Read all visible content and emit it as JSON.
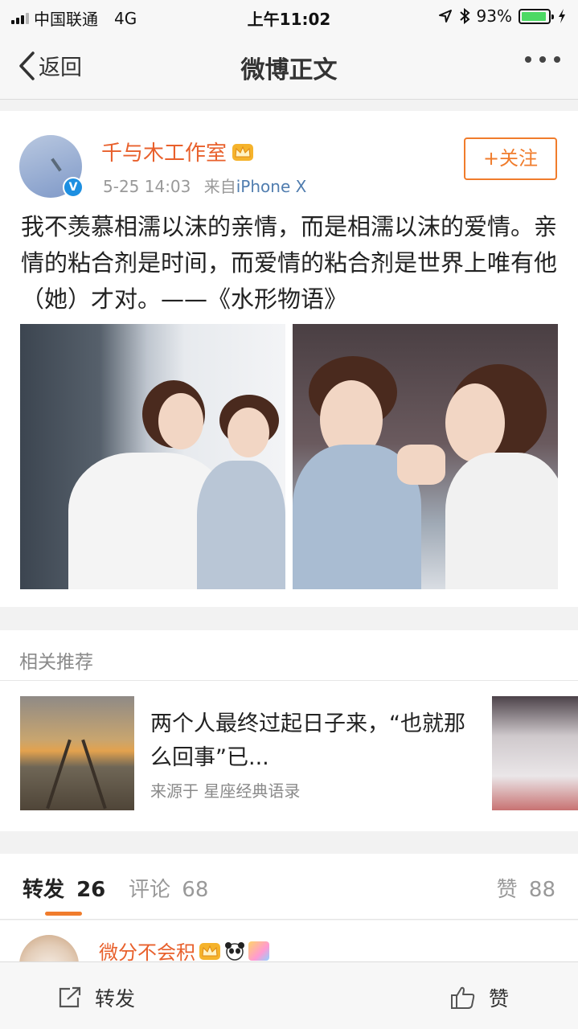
{
  "status_bar": {
    "carrier": "中国联通",
    "network": "4G",
    "time": "上午11:02",
    "battery": "93%",
    "battery_level": 0.93
  },
  "nav": {
    "back_label": "返回",
    "title": "微博正文"
  },
  "post": {
    "author": "千与木工作室",
    "timestamp": "5-25 14:03",
    "source_prefix": "来自",
    "source_device": "iPhone X",
    "follow_label": "+关注",
    "text": "我不羡慕相濡以沫的亲情，而是相濡以沫的爱情。亲情的粘合剂是时间，而爱情的粘合剂是世界上唯有他（她）才对。——《水形物语》",
    "verified_badge": "V"
  },
  "related": {
    "section_title": "相关推荐",
    "item": {
      "headline": "两个人最终过起日子来，“也就那么回事”已...",
      "source": "来源于 星座经典语录"
    }
  },
  "interactions": {
    "repost_label": "转发",
    "repost_count": "26",
    "comment_label": "评论",
    "comment_count": "68",
    "like_label": "赞",
    "like_count": "88"
  },
  "comment_preview": {
    "author": "微分不会积"
  },
  "toolbar": {
    "repost_label": "转发",
    "like_label": "赞"
  },
  "colors": {
    "accent": "#f07c2c",
    "author_name": "#e8602c",
    "link": "#507daf",
    "verified": "#1d8fe1"
  }
}
